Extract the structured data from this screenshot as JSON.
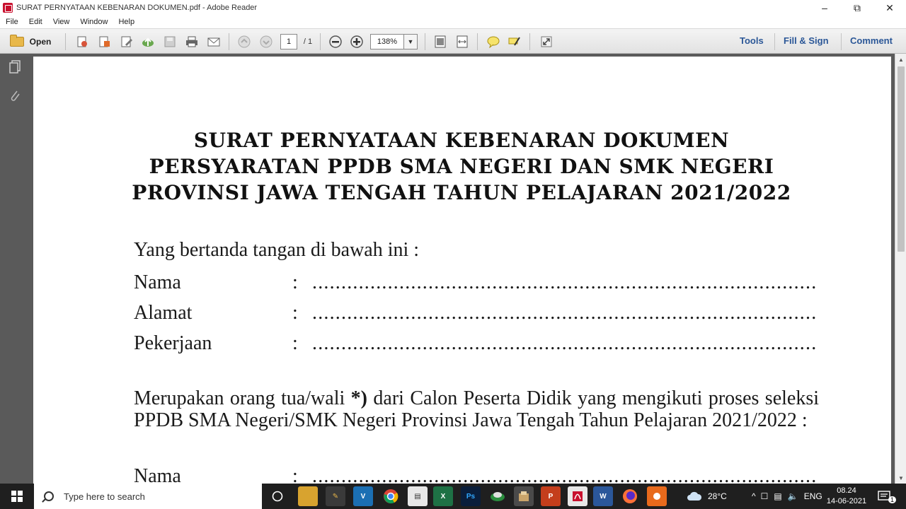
{
  "window": {
    "title": "SURAT PERNYATAAN KEBENARAN DOKUMEN.pdf - Adobe Reader",
    "minimize": "–",
    "restore": "⧉",
    "close": "✕"
  },
  "menu": [
    "File",
    "Edit",
    "View",
    "Window",
    "Help"
  ],
  "toolbar": {
    "open_label": "Open",
    "page_current": "1",
    "page_total": "/ 1",
    "zoom": "138%",
    "tools": "Tools",
    "fill_sign": "Fill & Sign",
    "comment": "Comment"
  },
  "document": {
    "title_lines": [
      "SURAT PERNYATAAN KEBENARAN DOKUMEN",
      "PERSYARATAN PPDB SMA NEGERI DAN SMK NEGERI",
      "PROVINSI JAWA TENGAH TAHUN PELAJARAN 2021/2022"
    ],
    "intro": "Yang bertanda tangan di bawah ini :",
    "fields": [
      {
        "label": "Nama",
        "colon": ":",
        "dots": "........................................................................................."
      },
      {
        "label": "Alamat",
        "colon": ":",
        "dots": "........................................................................................."
      },
      {
        "label": "Pekerjaan",
        "colon": ":",
        "dots": "........................................................................................."
      }
    ],
    "paragraph_start": "Merupakan orang tua/wali ",
    "paragraph_bold": "*)",
    "paragraph_rest": " dari Calon Peserta Didik yang mengikuti proses seleksi PPDB SMA Negeri/SMK Negeri Provinsi Jawa Tengah Tahun Pelajaran 2021/2022 :",
    "fields2": [
      {
        "label": "Nama",
        "colon": ":",
        "dots": "........................................................................................."
      }
    ]
  },
  "taskbar": {
    "search_placeholder": "Type here to search",
    "weather": "28°C",
    "language": "ENG",
    "time": "08.24",
    "date": "14-06-2021",
    "notification_count": "1"
  },
  "colors": {
    "accent_link": "#2b5797",
    "nav_gray": "#5a5a5a",
    "taskbar": "#1f1f1f"
  }
}
